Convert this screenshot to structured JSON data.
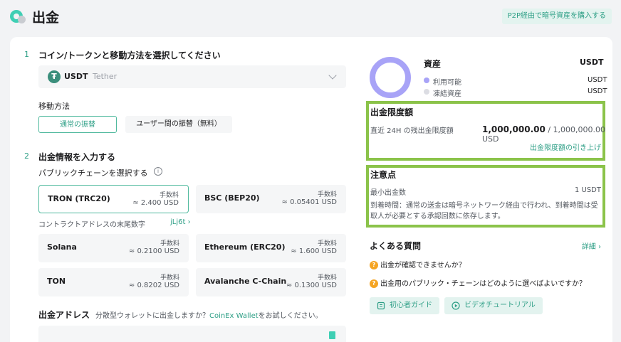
{
  "header": {
    "title": "出金",
    "p2p_button": "P2P経由で暗号資産を購入する"
  },
  "step1": {
    "num": "1",
    "title": "コイン/トークンと移動方法を選択してください",
    "coin_code": "USDT",
    "coin_name": "Tether",
    "method_label": "移動方法",
    "method_options": [
      "通常の振替",
      "ユーザー間の振替（無料）"
    ]
  },
  "step2": {
    "num": "2",
    "title": "出金情報を入力する",
    "chain_label": "パブリックチェーンを選択する",
    "fee_label": "手数料",
    "chains": [
      {
        "name": "TRON (TRC20)",
        "fee": "≈ 2.400 USD"
      },
      {
        "name": "BSC (BEP20)",
        "fee": "≈ 0.05401 USD"
      },
      {
        "name": "Solana",
        "fee": "≈ 0.2100 USD"
      },
      {
        "name": "Ethereum (ERC20)",
        "fee": "≈ 1.600 USD"
      },
      {
        "name": "TON",
        "fee": "≈ 0.8202 USD"
      },
      {
        "name": "Avalanche C-Chain",
        "fee": "≈ 0.1300 USD"
      }
    ],
    "contract_label": "コントラクトアドレスの末尾数字",
    "contract_value": "jLj6t ›",
    "address_title": "出金アドレス",
    "address_hint_pre": "分散型ウォレットに出金しますか？",
    "address_hint_link": "CoinEx Wallet",
    "address_hint_post": "をお試しください。"
  },
  "assets": {
    "title": "資産",
    "unit": "USDT",
    "available_label": "利用可能",
    "available_value": "USDT",
    "frozen_label": "凍結資産",
    "frozen_value": "USDT",
    "colors": {
      "available": "#a8a3f7",
      "frozen": "#dcdde3"
    }
  },
  "limit": {
    "title": "出金限度額",
    "label": "直近 24H の残出金限度額",
    "remaining": "1,000,000.00",
    "total": "/ 1,000,000.00 USD",
    "link": "出金限度額の引き上げ"
  },
  "notes": {
    "title": "注意点",
    "min_label": "最小出金数",
    "min_value": "1 USDT",
    "text": "到着時間：通常の送金は暗号ネットワーク経由で行われ、到着時間は受取人が必要とする承認回数に依存します。"
  },
  "faq": {
    "title": "よくある質問",
    "more": "詳細 ›",
    "items": [
      "出金が確認できませんか？",
      "出金用のパブリック・チェーンはどのように選べばよいですか？"
    ],
    "buttons": [
      "初心者ガイド",
      "ビデオチュートリアル"
    ]
  },
  "colors": {
    "accent": "#2e9f86",
    "highlight_box": "#8bc34a"
  }
}
